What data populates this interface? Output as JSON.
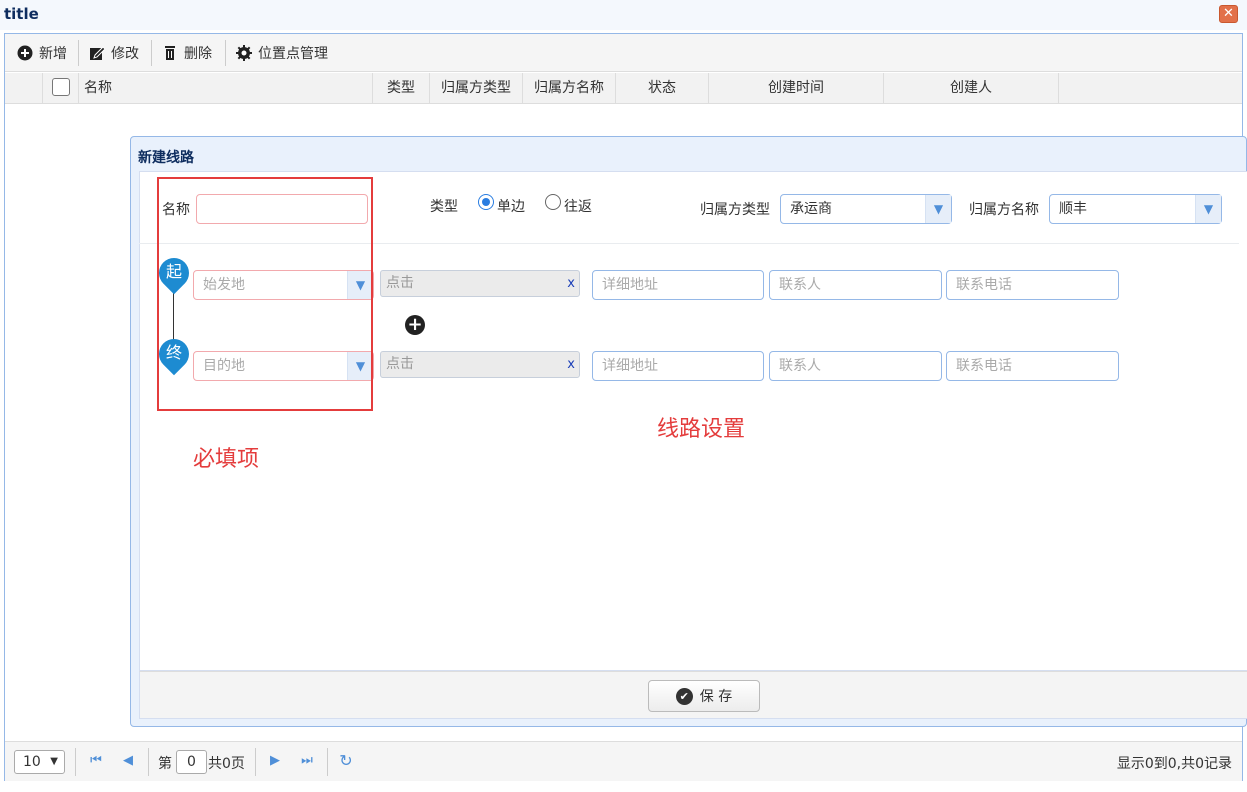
{
  "window": {
    "title": "title",
    "close_icon": "close-icon"
  },
  "toolbar": {
    "add_label": "新增",
    "edit_label": "修改",
    "delete_label": "删除",
    "location_label": "位置点管理"
  },
  "grid": {
    "columns": [
      "名称",
      "类型",
      "归属方类型",
      "归属方名称",
      "状态",
      "创建时间",
      "创建人"
    ]
  },
  "pager": {
    "page_size": "10",
    "page_prefix": "第",
    "page_number": "0",
    "page_suffix": "共0页",
    "info": "显示0到0,共0记录"
  },
  "dialog": {
    "title": "新建线路",
    "name_label": "名称",
    "name_value": "",
    "type_label": "类型",
    "type_options": [
      "单边",
      "往返"
    ],
    "type_selected": "单边",
    "owner_type_label": "归属方类型",
    "owner_type_value": "承运商",
    "owner_name_label": "归属方名称",
    "owner_name_value": "顺丰",
    "start_pin": "起",
    "end_pin": "终",
    "origin_placeholder": "始发地",
    "destination_placeholder": "目的地",
    "click_placeholder": "点击",
    "clear_x": "x",
    "address_placeholder": "详细地址",
    "contact_placeholder": "联系人",
    "phone_placeholder": "联系电话",
    "save_label": "保 存"
  },
  "annotations": {
    "required_label": "必填项",
    "route_label": "线路设置",
    "color": "#e43c3c"
  },
  "colors": {
    "accent": "#1d8bd1",
    "border": "#95b8e7",
    "title_text": "#0e2d5f"
  }
}
